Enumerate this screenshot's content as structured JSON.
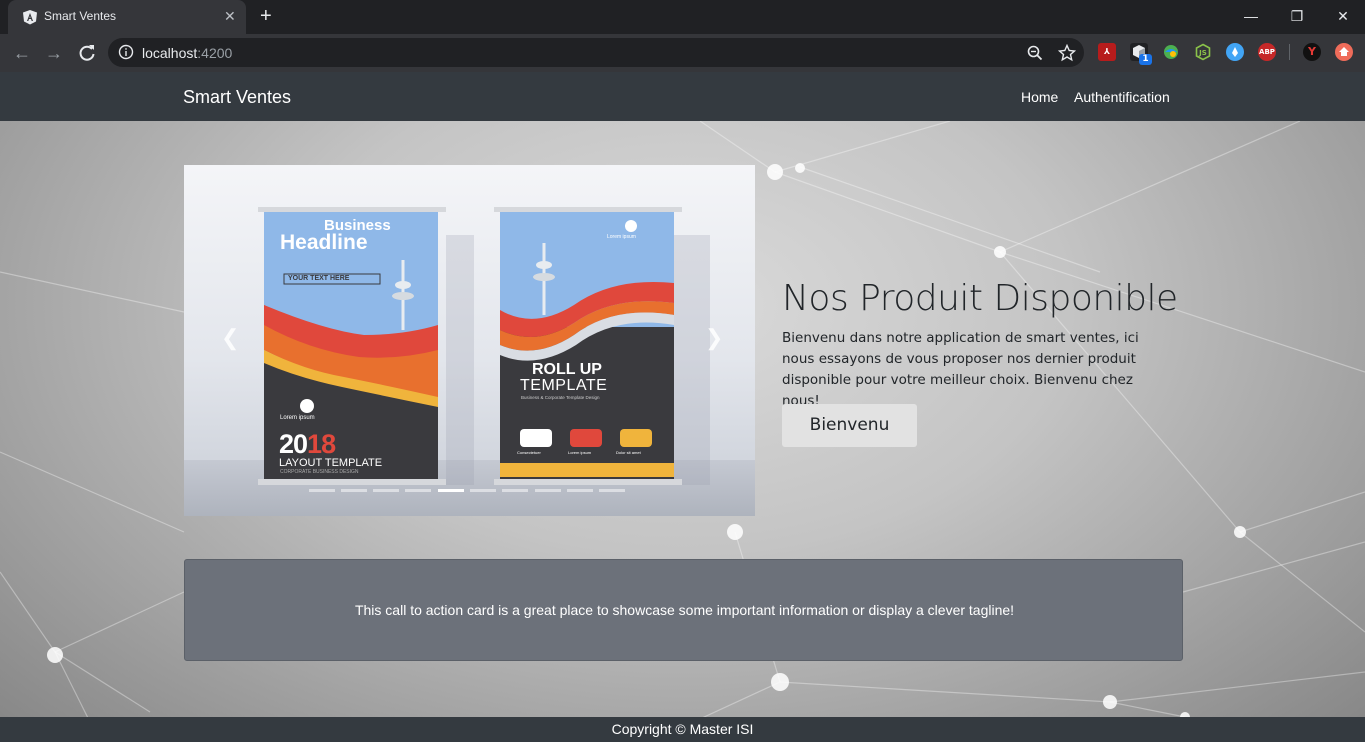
{
  "browser": {
    "tab_title": "Smart Ventes",
    "url_host": "localhost",
    "url_port": ":4200",
    "extensions": [
      "pdf-icon",
      "cube-icon",
      "globe-icon",
      "nodejs-icon",
      "drop-icon",
      "abp-icon",
      "yandex-icon",
      "bookmark-icon"
    ],
    "ext_badge": "1",
    "abp_label": "ABP"
  },
  "navbar": {
    "brand": "Smart Ventes",
    "links": [
      "Home",
      "Authentification"
    ]
  },
  "carousel": {
    "slide": {
      "banner_left": {
        "title_line1": "Business",
        "title_line2": "Headline",
        "tag": "YOUR TEXT HERE",
        "lorem": "Lorem ipsum",
        "year_prefix": "20",
        "year_suffix": "18",
        "layout": "LAYOUT TEMPLATE",
        "sub": "CORPORATE BUSINESS DESIGN"
      },
      "banner_right": {
        "lorem": "Lorem ipsum",
        "title_line1": "ROLL UP",
        "title_line2": "TEMPLATE",
        "sub": "Business & Corporate Template Design",
        "icon_labels": [
          "Consectetuer",
          "Lorem ipsum",
          "Dolor sit amet"
        ]
      }
    },
    "indicator_count": 10,
    "active_index": 4
  },
  "hero": {
    "title": "Nos Produit Disponible",
    "text": "Bienvenu dans notre application de smart ventes, ici nous essayons de vous proposer nos dernier produit disponible pour votre meilleur choix. Bienvenu chez nous!",
    "button_label": "Bienvenu"
  },
  "cta": {
    "text": "This call to action card is a great place to showcase some important information or display a clever tagline!"
  },
  "footer": {
    "text": "Copyright © Master ISI"
  },
  "colors": {
    "navbar": "#343a40",
    "cta_card": "#6c717a",
    "banner_red": "#e0483c",
    "banner_orange": "#e8702e",
    "banner_yellow": "#f0b43c",
    "banner_dark": "#3a3a3e"
  }
}
